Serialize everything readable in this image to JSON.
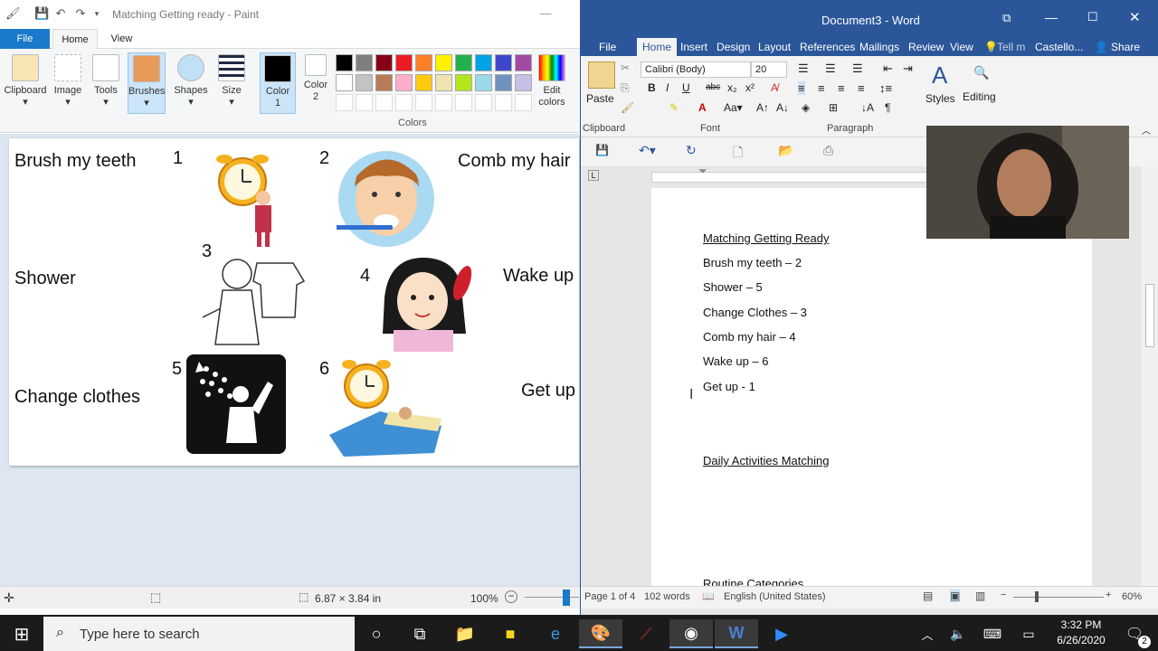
{
  "paint": {
    "title": "Matching Getting ready - Paint",
    "tabs": [
      "File",
      "Home",
      "View"
    ],
    "ribbon": {
      "clipboard": "Clipboard",
      "image": "Image",
      "tools": "Tools",
      "brushes": "Brushes",
      "shapes": "Shapes",
      "size": "Size",
      "color1": "Color 1",
      "color2": "Color 2",
      "edit_colors": "Edit colors",
      "colors_group": "Colors"
    },
    "palette": [
      "#000000",
      "#7f7f7f",
      "#880015",
      "#ed1c24",
      "#ff7f27",
      "#fff200",
      "#22b14c",
      "#00a2e8",
      "#3f48cc",
      "#a349a4",
      "#ffffff",
      "#c3c3c3",
      "#b97a57",
      "#ffaec9",
      "#ffc90e",
      "#efe4b0",
      "#b5e61d",
      "#99d9ea",
      "#7092be",
      "#c8bfe7"
    ],
    "canvas": {
      "labels": [
        "Brush my teeth",
        "Shower",
        "Change clothes",
        "Comb my hair",
        "Wake up",
        "Get up"
      ],
      "numbers": [
        "1",
        "2",
        "3",
        "4",
        "5",
        "6"
      ]
    },
    "status": {
      "size": "6.87 × 3.84 in",
      "zoom": "100%"
    }
  },
  "word": {
    "title": "Document3 - Word",
    "tabs": [
      "File",
      "Home",
      "Insert",
      "Design",
      "Layout",
      "References",
      "Mailings",
      "Review",
      "View"
    ],
    "tell_me": "Tell m",
    "user": "Castello...",
    "share": "Share",
    "font_name": "Calibri (Body)",
    "font_size": "20",
    "groups": {
      "clipboard": "Clipboard",
      "font": "Font",
      "paragraph": "Paragraph"
    },
    "paste": "Paste",
    "styles": "Styles",
    "editing": "Editing",
    "doc": {
      "heading1": "Matching Getting Ready",
      "lines": [
        "Brush my teeth – 2",
        "Shower – 5",
        "Change Clothes – 3",
        "Comb my hair – 4",
        "Wake up – 6",
        "Get up - 1"
      ],
      "heading2": "Daily Activities Matching",
      "heading3": "Routine Categories"
    },
    "status": {
      "page": "Page 1 of 4",
      "words": "102 words",
      "lang": "English (United States)",
      "zoom": "60%"
    }
  },
  "taskbar": {
    "search_placeholder": "Type here to search",
    "time": "3:32 PM",
    "date": "6/26/2020",
    "notification_count": "2"
  }
}
